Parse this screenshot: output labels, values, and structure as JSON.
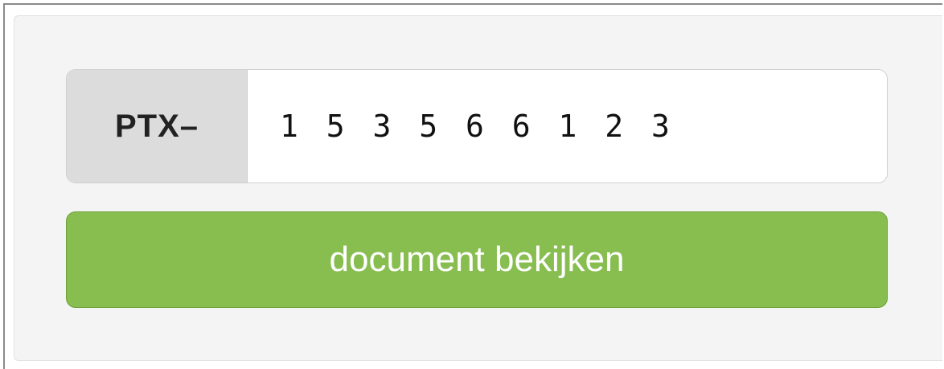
{
  "form": {
    "prefix_label": "PTX–",
    "code_value": "1 5 3 5 6 6 1 2 3",
    "submit_label": "document bekijken"
  },
  "colors": {
    "button_green": "#88bd50",
    "prefix_background": "#dcdcdc",
    "panel_background": "#f4f4f4"
  }
}
